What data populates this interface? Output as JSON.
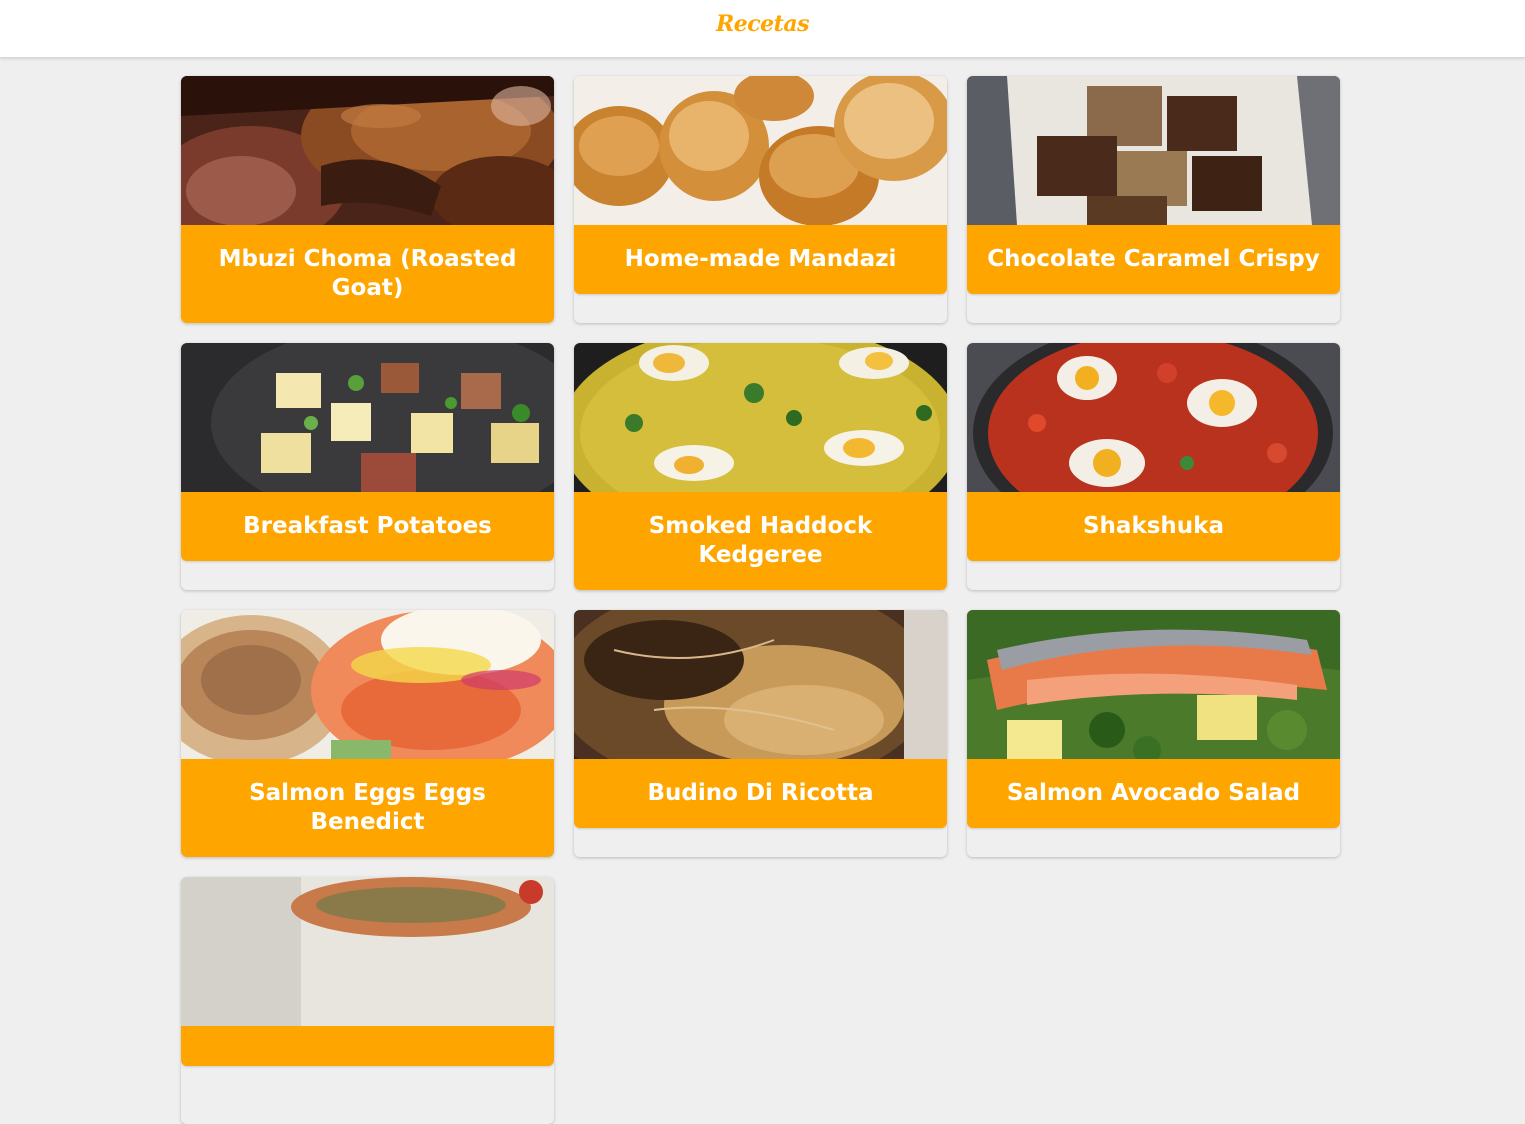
{
  "header": {
    "title": "Recetas"
  },
  "colors": {
    "accent": "#ffa500",
    "background": "#efefef",
    "header_bg": "#ffffff"
  },
  "recipes": [
    {
      "title": "Mbuzi Choma (Roasted Goat)"
    },
    {
      "title": "Home-made Mandazi"
    },
    {
      "title": "Chocolate Caramel Crispy"
    },
    {
      "title": "Breakfast Potatoes"
    },
    {
      "title": "Smoked Haddock Kedgeree"
    },
    {
      "title": "Shakshuka"
    },
    {
      "title": "Salmon Eggs Eggs Benedict"
    },
    {
      "title": "Budino Di Ricotta"
    },
    {
      "title": "Salmon Avocado Salad"
    },
    {
      "title": ""
    }
  ]
}
